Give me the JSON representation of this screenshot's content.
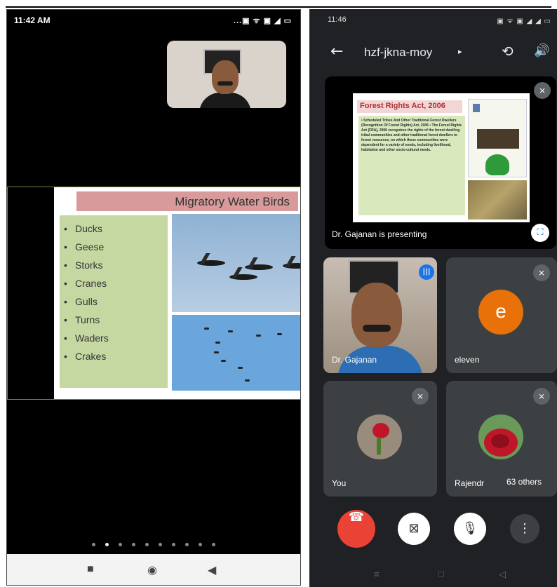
{
  "left_phone": {
    "status_time": "11:42 AM",
    "status_icons": "...▣ ᯤ ▣ ◢ ▭",
    "slide": {
      "title": "Migratory Water Birds",
      "items": [
        "Ducks",
        "Geese",
        "Storks",
        "Cranes",
        "Gulls",
        "Turns",
        "Waders",
        "Crakes"
      ]
    },
    "page_dots": 10,
    "active_dot": 1
  },
  "right_phone": {
    "status_time": "11:46",
    "meeting_code": "hzf-jkna-moy",
    "presenting_label": "Dr. Gajanan is presenting",
    "shared_slide_title": "Forest Rights Act, 2006",
    "shared_slide_text": "• Scheduled Tribes And Other Traditional Forest Dwellers (Recognition Of Forest Rights) Act, 2006 • The Forest Rights Act (FRA), 2006 recognizes the rights of the forest dwelling tribal communities and other traditional forest dwellers to forest resources, on which these communities were dependent for a variety of needs, including livelihood, habitation and other socio-cultural needs.",
    "participants": [
      {
        "name": "Dr. Gajanan",
        "speaking": true
      },
      {
        "name": "eleven",
        "initial": "e",
        "avatar_color": "#e8710a",
        "muted": true
      },
      {
        "name": "You",
        "muted": true
      },
      {
        "name": "Rajendr",
        "muted": true
      }
    ],
    "others_label": "63 others",
    "controls": [
      "end-call",
      "camera-off",
      "mic-off",
      "more-options"
    ],
    "accent_color": "#1a73e8",
    "end_call_color": "#ea4335"
  }
}
